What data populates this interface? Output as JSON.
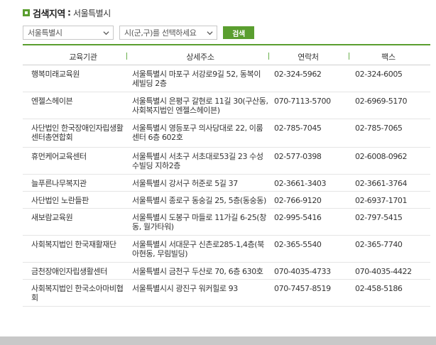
{
  "header": {
    "title": "검색지역",
    "colon": ":",
    "region": "서울특별시"
  },
  "controls": {
    "city_value": "서울특별시",
    "district_placeholder": "시(군,구)를 선택하세요",
    "search_label": "검색"
  },
  "table": {
    "columns": [
      "교육기관",
      "상세주소",
      "연락처",
      "팩스"
    ],
    "rows": [
      {
        "name": "행복미래교육원",
        "addr": "서울특별시 마포구 서강로9길 52, 동복이 세빌딩 2층",
        "tel": "02-324-5962",
        "fax": "02-324-6005"
      },
      {
        "name": "엔젤스헤이븐",
        "addr": "서울특별시 은평구 갈현로 11길 30(구산동, 사회복지법인 엔젤스헤이븐)",
        "tel": "070-7113-5700",
        "fax": "02-6969-5170"
      },
      {
        "name": "사단법인 한국장애인자립생활센터총연합회",
        "addr": "서울특별시 영등포구 의사당대로 22, 이룸센터 6층 602호",
        "tel": "02-785-7045",
        "fax": "02-785-7065"
      },
      {
        "name": "휴먼케어교육센터",
        "addr": "서울특별시 서초구 서초대로53길 23 수성수빌딩 지하2층",
        "tel": "02-577-0398",
        "fax": "02-6008-0962"
      },
      {
        "name": "늘푸른나무복지관",
        "addr": "서울특별시 강서구 허준로 5길 37",
        "tel": "02-3661-3403",
        "fax": "02-3661-3764"
      },
      {
        "name": "사단법인 노란들판",
        "addr": "서울특별시 종로구 동숭길 25, 5층(동숭동)",
        "tel": "02-766-9120",
        "fax": "02-6937-1701"
      },
      {
        "name": "새보람교육원",
        "addr": "서울특별시 도봉구 마들로 11가길 6-25(창동, 월가타워)",
        "tel": "02-995-5416",
        "fax": "02-797-5415"
      },
      {
        "name": "사회복지법인 한국재활재단",
        "addr": "서울특별시 서대문구 신촌로285-1,4층(북아현동, 무림빌딩)",
        "tel": "02-365-5540",
        "fax": "02-365-7740"
      },
      {
        "name": "금천장애인자립생활센터",
        "addr": "서울특별시 금천구 두산로 70, 6층 630호",
        "tel": "070-4035-4733",
        "fax": "070-4035-4422"
      },
      {
        "name": "사회복지법인 한국소아마비협회",
        "addr": "서울특별시시 광진구 워커힐로 93",
        "tel": "070-7457-8519",
        "fax": "02-458-5186"
      }
    ]
  },
  "colors": {
    "accent": "#5a9e2f"
  }
}
